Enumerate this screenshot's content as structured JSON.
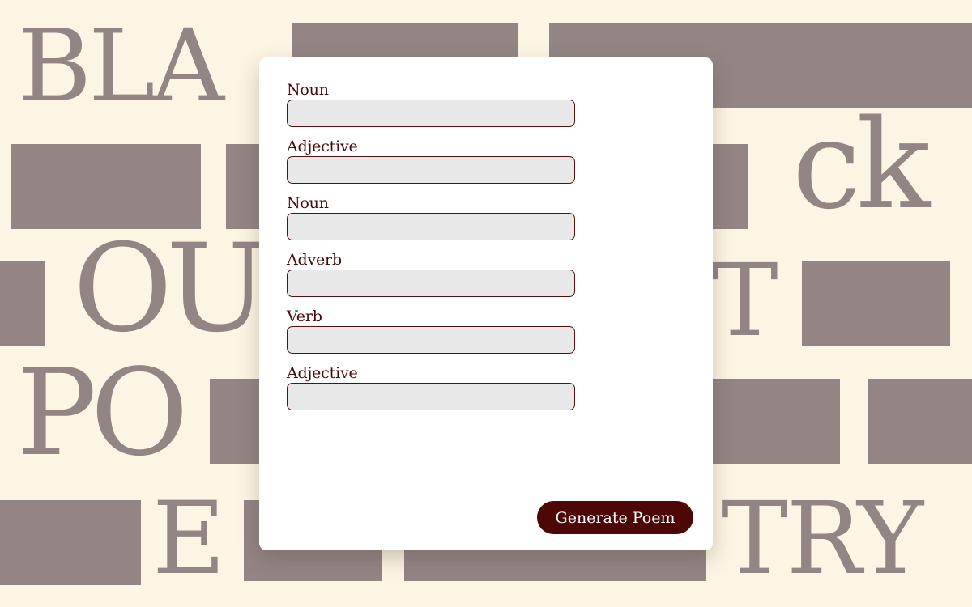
{
  "background": {
    "words": [
      "BLA",
      "ck",
      "OU",
      "T",
      "PO",
      "E",
      "TRY"
    ]
  },
  "form": {
    "fields": [
      {
        "label": "Noun",
        "value": ""
      },
      {
        "label": "Adjective",
        "value": ""
      },
      {
        "label": "Noun",
        "value": ""
      },
      {
        "label": "Adverb",
        "value": ""
      },
      {
        "label": "Verb",
        "value": ""
      },
      {
        "label": "Adjective",
        "value": ""
      }
    ],
    "submit_label": "Generate Poem"
  },
  "colors": {
    "page_background": "#fdf5e4",
    "blackout_gray": "#928584",
    "accent_maroon": "#4e0707",
    "input_fill": "#e8e8e8",
    "card_background": "#ffffff"
  }
}
